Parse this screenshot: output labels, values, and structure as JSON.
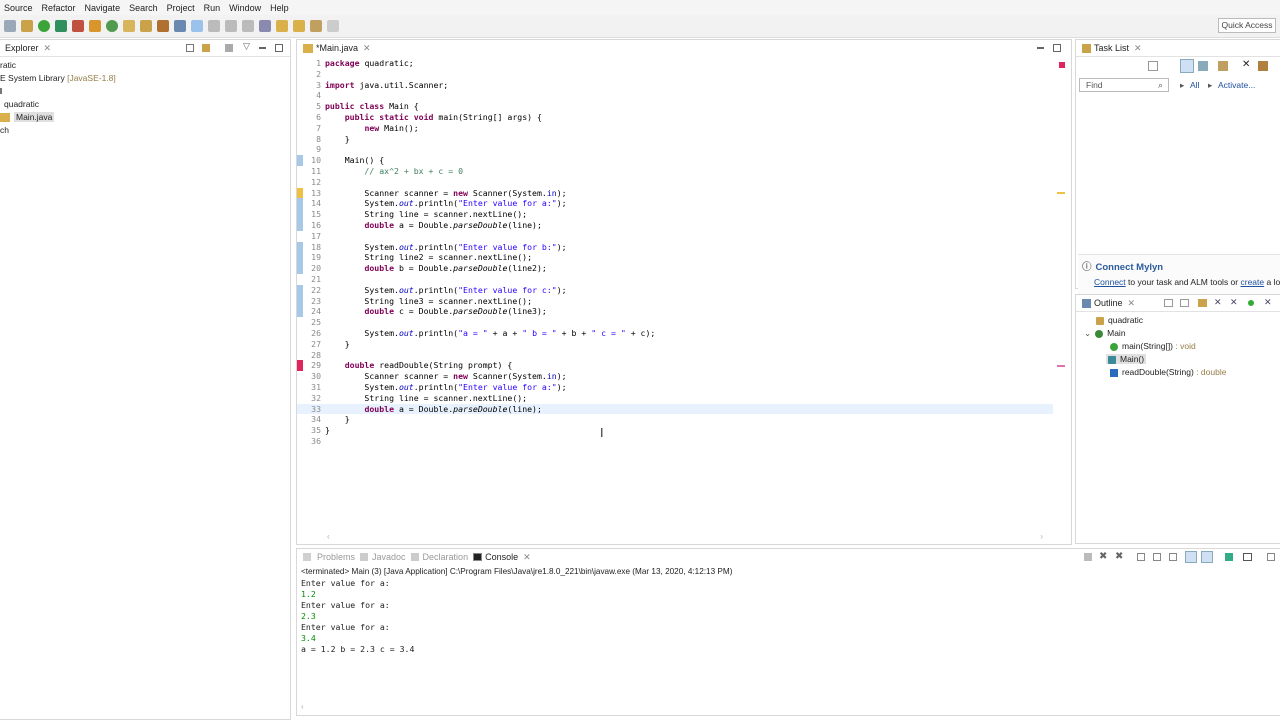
{
  "menu": [
    "Source",
    "Refactor",
    "Navigate",
    "Search",
    "Project",
    "Run",
    "Window",
    "Help"
  ],
  "quick_access": "Quick Access",
  "explorer": {
    "tab": "Explorer",
    "items": [
      "ratic",
      "E System Library",
      "[JavaSE-1.8]",
      "quadratic",
      "Main.java",
      "ch"
    ]
  },
  "editor": {
    "tab": "*Main.java",
    "lines": [
      {
        "n": "1",
        "t": "package quadratic;"
      },
      {
        "n": "2",
        "t": ""
      },
      {
        "n": "3",
        "t": "import java.util.Scanner;"
      },
      {
        "n": "4",
        "t": ""
      },
      {
        "n": "5",
        "t": "public class Main {"
      },
      {
        "n": "6",
        "t": "    public static void main(String[] args) {"
      },
      {
        "n": "7",
        "t": "        new Main();"
      },
      {
        "n": "8",
        "t": "    }"
      },
      {
        "n": "9",
        "t": ""
      },
      {
        "n": "10",
        "t": "    Main() {"
      },
      {
        "n": "11",
        "t": "        // ax^2 + bx + c = 0"
      },
      {
        "n": "12",
        "t": ""
      },
      {
        "n": "13",
        "t": "        Scanner scanner = new Scanner(System.in);"
      },
      {
        "n": "14",
        "t": "        System.out.println(\"Enter value for a:\");"
      },
      {
        "n": "15",
        "t": "        String line = scanner.nextLine();"
      },
      {
        "n": "16",
        "t": "        double a = Double.parseDouble(line);"
      },
      {
        "n": "17",
        "t": ""
      },
      {
        "n": "18",
        "t": "        System.out.println(\"Enter value for b:\");"
      },
      {
        "n": "19",
        "t": "        String line2 = scanner.nextLine();"
      },
      {
        "n": "20",
        "t": "        double b = Double.parseDouble(line2);"
      },
      {
        "n": "21",
        "t": ""
      },
      {
        "n": "22",
        "t": "        System.out.println(\"Enter value for c:\");"
      },
      {
        "n": "23",
        "t": "        String line3 = scanner.nextLine();"
      },
      {
        "n": "24",
        "t": "        double c = Double.parseDouble(line3);"
      },
      {
        "n": "25",
        "t": ""
      },
      {
        "n": "26",
        "t": "        System.out.println(\"a = \" + a + \" b = \" + b + \" c = \" + c);"
      },
      {
        "n": "27",
        "t": "    }"
      },
      {
        "n": "28",
        "t": ""
      },
      {
        "n": "29",
        "t": "    double readDouble(String prompt) {"
      },
      {
        "n": "30",
        "t": "        Scanner scanner = new Scanner(System.in);"
      },
      {
        "n": "31",
        "t": "        System.out.println(\"Enter value for a:\");"
      },
      {
        "n": "32",
        "t": "        String line = scanner.nextLine();"
      },
      {
        "n": "33",
        "t": "        double a = Double.parseDouble(line);"
      },
      {
        "n": "34",
        "t": "    }"
      },
      {
        "n": "35",
        "t": "}"
      },
      {
        "n": "36",
        "t": ""
      }
    ]
  },
  "bottom_tabs": [
    "Problems",
    "Javadoc",
    "Declaration",
    "Console"
  ],
  "console": {
    "header": "<terminated> Main (3) [Java Application] C:\\Program Files\\Java\\jre1.8.0_221\\bin\\javaw.exe (Mar 13, 2020, 4:12:13 PM)",
    "lines": [
      {
        "t": "Enter value for a:",
        "c": ""
      },
      {
        "t": "1.2",
        "c": "green"
      },
      {
        "t": "Enter value for a:",
        "c": ""
      },
      {
        "t": "2.3",
        "c": "green"
      },
      {
        "t": "Enter value for a:",
        "c": ""
      },
      {
        "t": "3.4",
        "c": "green"
      },
      {
        "t": "a = 1.2 b = 2.3 c = 3.4",
        "c": ""
      }
    ]
  },
  "tasklist": {
    "tab": "Task List",
    "find_placeholder": "Find",
    "all": "All",
    "activate": "Activate..."
  },
  "mylyn": {
    "title": "Connect Mylyn",
    "connect": "Connect",
    "text": " to your task and ALM tools or ",
    "create": "create",
    "tail": " a lo"
  },
  "outline": {
    "tab": "Outline",
    "items": [
      {
        "label": "quadratic",
        "suffix": ""
      },
      {
        "label": "Main",
        "suffix": ""
      },
      {
        "label": "main(String[])",
        "suffix": " : void"
      },
      {
        "label": "Main()",
        "suffix": ""
      },
      {
        "label": "readDouble(String)",
        "suffix": " : double"
      }
    ]
  }
}
